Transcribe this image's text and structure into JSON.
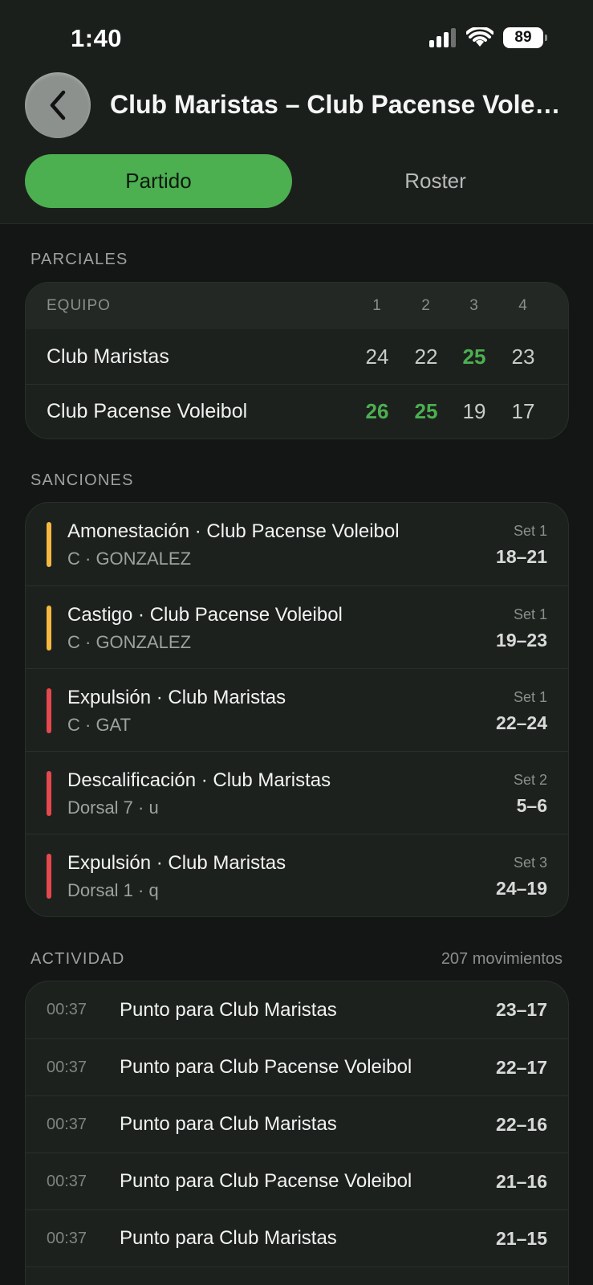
{
  "status_bar": {
    "time": "1:40",
    "battery": "89",
    "icons": [
      "signal-icon",
      "wifi-icon",
      "battery-icon"
    ]
  },
  "header": {
    "back_icon": "chevron-left-icon",
    "title": "Club Maristas – Club Pacense Voleibol"
  },
  "tabs": [
    {
      "label": "Partido",
      "active": true
    },
    {
      "label": "Roster",
      "active": false
    }
  ],
  "colors": {
    "accent": "#4caf50",
    "warning": "#f5b942",
    "danger": "#e5484d",
    "background": "#131614",
    "card": "#1d211e"
  },
  "parciales": {
    "label": "PARCIALES",
    "header": {
      "team": "EQUIPO",
      "sets": [
        "1",
        "2",
        "3",
        "4"
      ]
    },
    "rows": [
      {
        "team": "Club Maristas",
        "scores": [
          "24",
          "22",
          "25",
          "23"
        ],
        "wins": [
          false,
          false,
          true,
          false
        ]
      },
      {
        "team": "Club Pacense Voleibol",
        "scores": [
          "26",
          "25",
          "19",
          "17"
        ],
        "wins": [
          true,
          true,
          false,
          false
        ]
      }
    ]
  },
  "sanciones": {
    "label": "SANCIONES",
    "items": [
      {
        "title": "Amonestación · Club Pacense Voleibol",
        "sub": "C · GONZALEZ",
        "set": "Set 1",
        "score": "18–21",
        "level": "yellow"
      },
      {
        "title": "Castigo · Club Pacense Voleibol",
        "sub": "C · GONZALEZ",
        "set": "Set 1",
        "score": "19–23",
        "level": "yellow"
      },
      {
        "title": "Expulsión · Club Maristas",
        "sub": "C · GAT",
        "set": "Set 1",
        "score": "22–24",
        "level": "red"
      },
      {
        "title": "Descalificación · Club Maristas",
        "sub": "Dorsal 7 · u",
        "set": "Set 2",
        "score": "5–6",
        "level": "red"
      },
      {
        "title": "Expulsión · Club Maristas",
        "sub": "Dorsal 1 · q",
        "set": "Set 3",
        "score": "24–19",
        "level": "red"
      }
    ]
  },
  "actividad": {
    "label": "ACTIVIDAD",
    "count": "207 movimientos",
    "items": [
      {
        "time": "00:37",
        "text": "Punto para Club Maristas",
        "score": "23–17"
      },
      {
        "time": "00:37",
        "text": "Punto para Club Pacense Voleibol",
        "score": "22–17"
      },
      {
        "time": "00:37",
        "text": "Punto para Club Maristas",
        "score": "22–16"
      },
      {
        "time": "00:37",
        "text": "Punto para Club Pacense Voleibol",
        "score": "21–16"
      },
      {
        "time": "00:37",
        "text": "Punto para Club Maristas",
        "score": "21–15"
      }
    ]
  }
}
